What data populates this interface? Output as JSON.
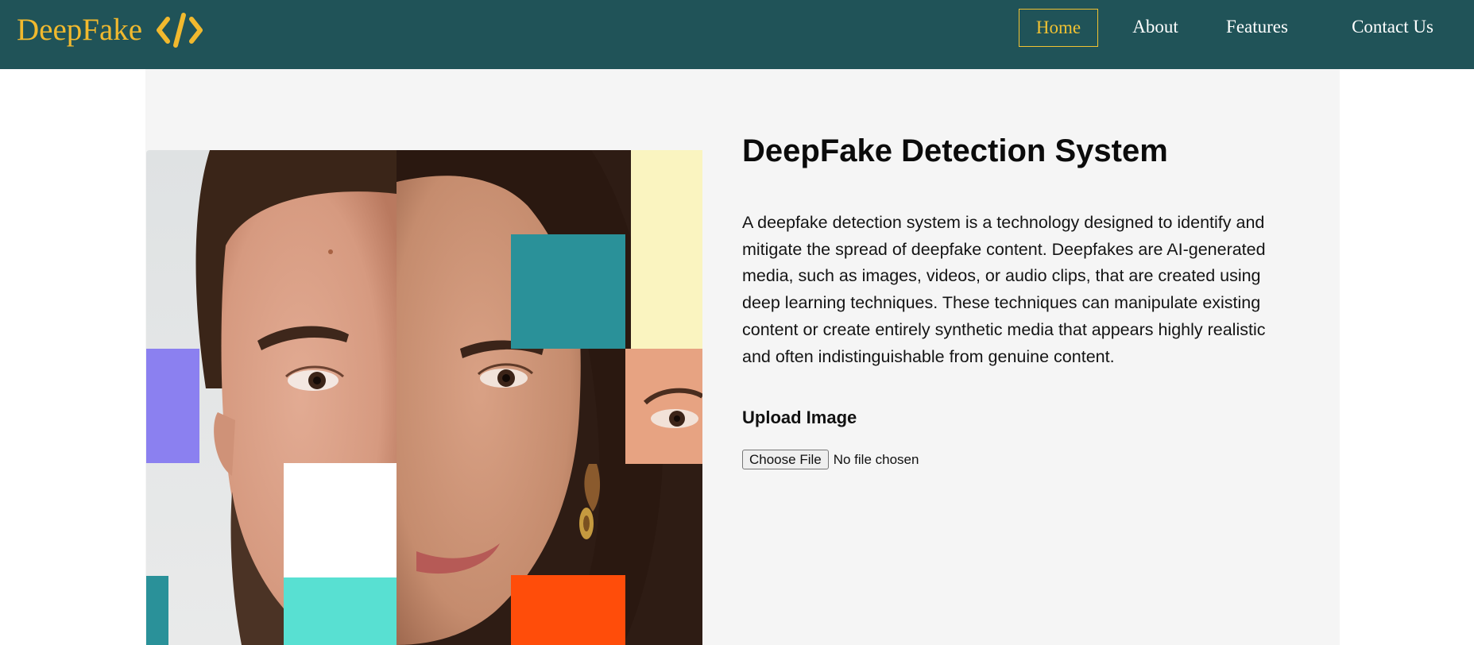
{
  "brand": {
    "name": "DeepFake",
    "icon": "code-brackets-icon"
  },
  "nav": {
    "items": [
      {
        "label": "Home",
        "active": true
      },
      {
        "label": "About",
        "active": false
      },
      {
        "label": "Features",
        "active": false
      },
      {
        "label": "Contact Us",
        "active": false
      }
    ]
  },
  "main": {
    "title": "DeepFake Detection System",
    "description": "A deepfake detection system is a technology designed to identify and mitigate the spread of deepfake content. Deepfakes are AI-generated media, such as images, videos, or audio clips, that are created using deep learning techniques. These techniques can manipulate existing content or create entirely synthetic media that appears highly realistic and often indistinguishable from genuine content.",
    "upload": {
      "label": "Upload Image",
      "button_label": "Choose File",
      "status": "No file chosen"
    }
  },
  "colors": {
    "navbar": "#205358",
    "brand": "#f1b92e",
    "nav_active": "#f1c232",
    "card_background": "#f5f5f5",
    "tile_teal": "#2a9199",
    "tile_purple": "#8b80f0",
    "tile_mint": "#58e0d2",
    "tile_orange": "#ff4d0a",
    "tile_cream": "#faf4c0"
  }
}
